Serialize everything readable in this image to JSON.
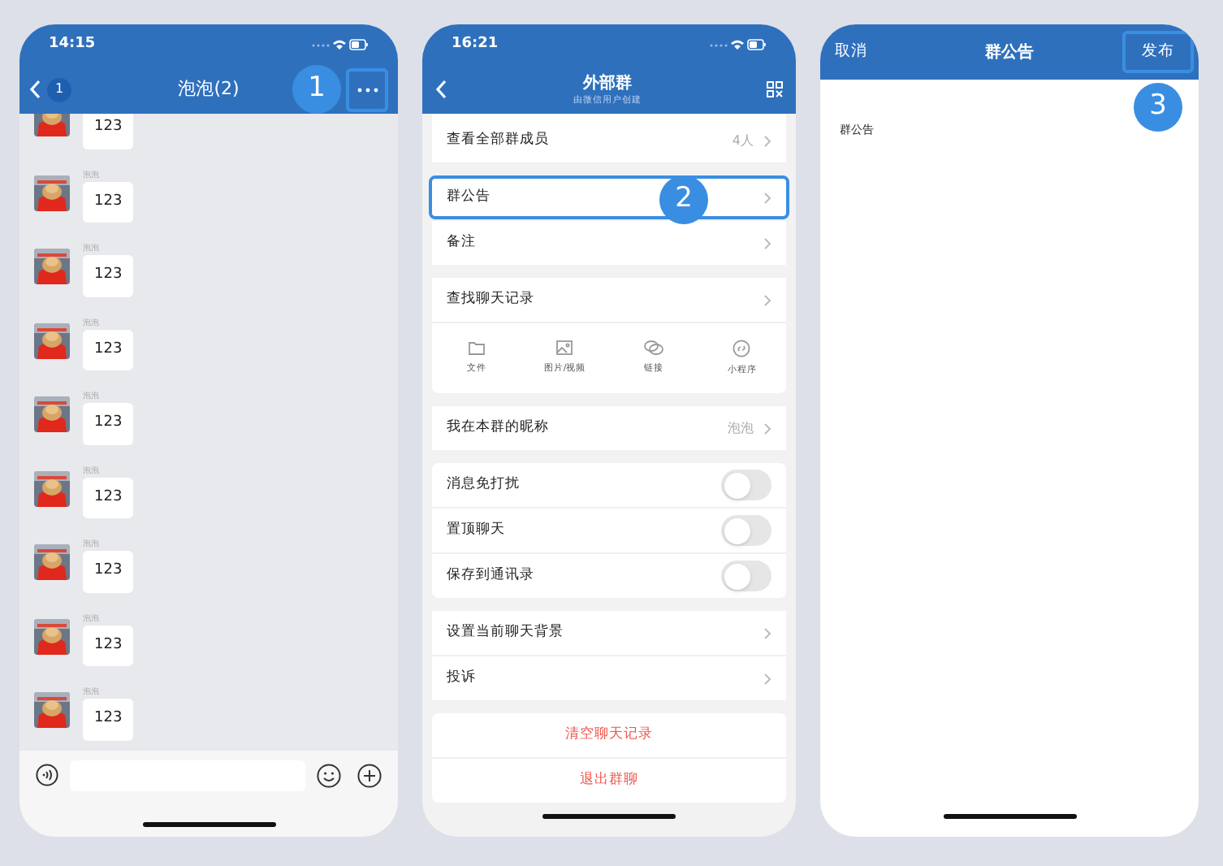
{
  "chat_screen": {
    "time": "14:15",
    "back_badge": "1",
    "title": "泡泡(2)",
    "more_highlighted": true,
    "callout": "1",
    "messages": [
      {
        "text": "123"
      },
      {
        "sender": "泡泡",
        "text": "123"
      },
      {
        "sender": "泡泡",
        "text": "123"
      },
      {
        "sender": "泡泡",
        "text": "123"
      },
      {
        "sender": "泡泡",
        "text": "123"
      },
      {
        "sender": "泡泡",
        "text": "123"
      },
      {
        "sender": "泡泡",
        "text": "123"
      },
      {
        "sender": "泡泡",
        "text": "123"
      },
      {
        "sender": "泡泡",
        "text": "123"
      }
    ]
  },
  "group_settings_screen": {
    "time": "16:21",
    "title": "外部群",
    "subtitle": "由微信用户创建",
    "callout": "2",
    "groups": [
      [
        {
          "kind": "link",
          "label": "查看全部群成员",
          "value": "4人",
          "highlighted": false
        }
      ],
      [
        {
          "kind": "link",
          "label": "群公告",
          "highlighted": true
        },
        {
          "kind": "link",
          "label": "备注",
          "highlighted": false
        }
      ],
      [
        {
          "kind": "link",
          "label": "查找聊天记录",
          "highlighted": false
        },
        {
          "kind": "shortcuts",
          "items": [
            {
              "label": "文件"
            },
            {
              "label": "图片/视频"
            },
            {
              "label": "链接"
            },
            {
              "label": "小程序"
            }
          ]
        }
      ],
      [
        {
          "kind": "link",
          "label": "我在本群的昵称",
          "value": "泡泡",
          "highlighted": false
        }
      ],
      [
        {
          "kind": "toggle",
          "label": "消息免打扰",
          "on": false
        },
        {
          "kind": "toggle",
          "label": "置顶聊天",
          "on": false
        },
        {
          "kind": "toggle",
          "label": "保存到通讯录",
          "on": false
        }
      ],
      [
        {
          "kind": "link",
          "label": "设置当前聊天背景",
          "highlighted": false
        },
        {
          "kind": "link",
          "label": "投诉",
          "highlighted": false
        }
      ],
      [
        {
          "kind": "danger",
          "label": "清空聊天记录"
        },
        {
          "kind": "danger",
          "label": "退出群聊"
        }
      ]
    ]
  },
  "announcement_screen": {
    "cancel": "取消",
    "title": "群公告",
    "publish": "发布",
    "publish_highlighted": true,
    "callout": "3",
    "body": "群公告"
  }
}
